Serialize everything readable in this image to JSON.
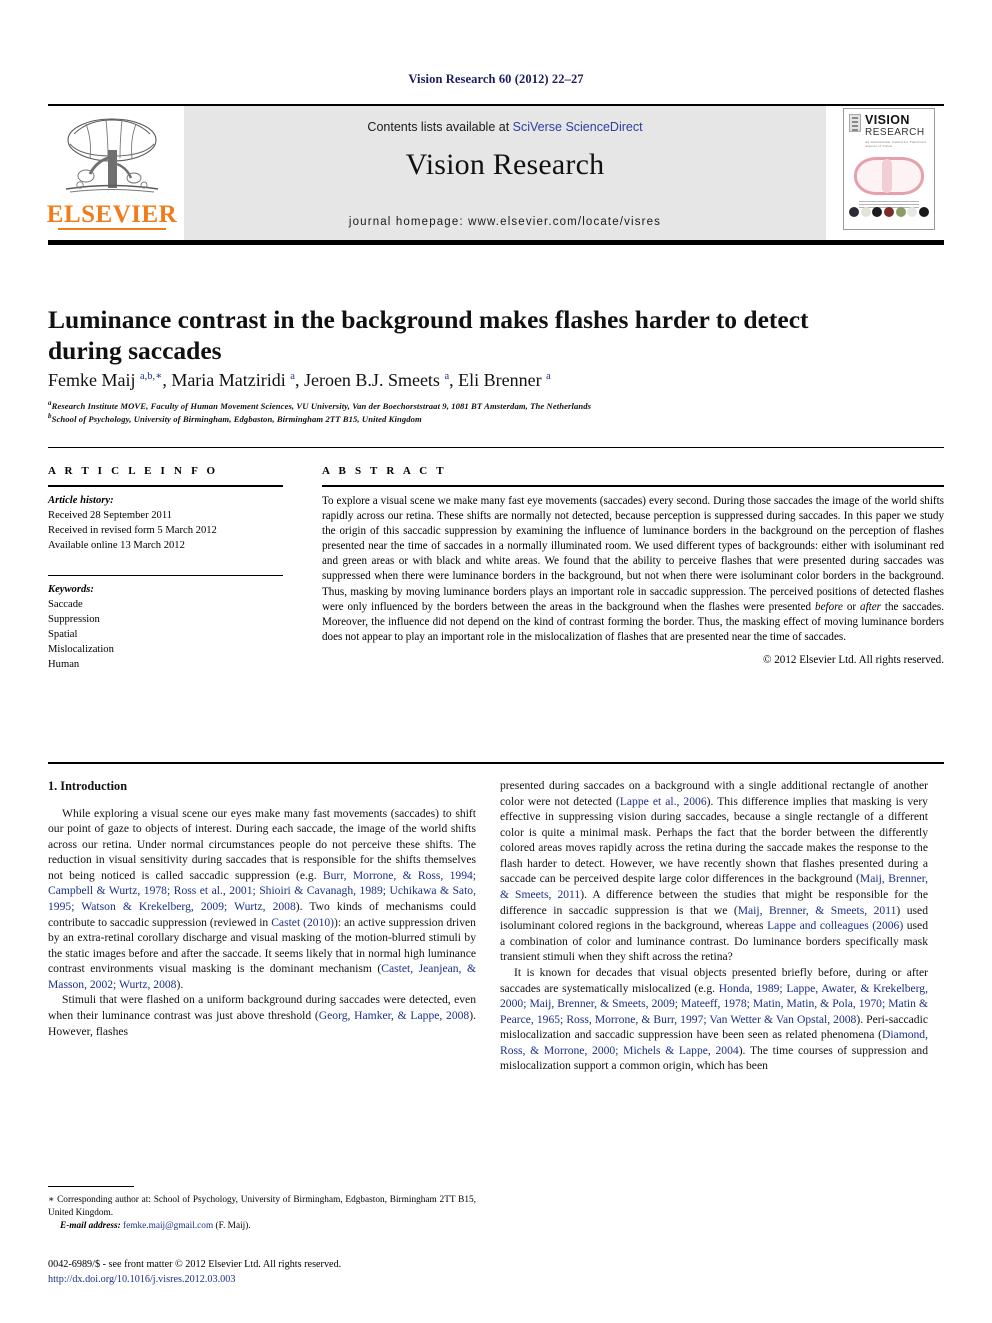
{
  "running_head": "Vision Research 60 (2012) 22–27",
  "masthead": {
    "publisher": "ELSEVIER",
    "contents_prefix": "Contents lists available at ",
    "contents_link": "SciVerse ScienceDirect",
    "journal_name": "Vision Research",
    "homepage": "journal homepage: www.elsevier.com/locate/visres",
    "cover": {
      "title_line1": "VISION",
      "title_line2": "RESEARCH",
      "subtitle": "An International Journal for Functional Aspects of Vision"
    }
  },
  "article": {
    "title": "Luminance contrast in the background makes flashes harder to detect during saccades",
    "authors_html": "Femke Maij <sup>a,b,∗</sup>, Maria Matziridi <sup>a</sup>, Jeroen B.J. Smeets <sup>a</sup>, Eli Brenner <sup>a</sup>",
    "affiliation_a": "Research Institute MOVE, Faculty of Human Movement Sciences, VU University, Van der Boechorststraat 9, 1081 BT Amsterdam, The Netherlands",
    "affiliation_b": "School of Psychology, University of Birmingham, Edgbaston, Birmingham 2TT B15, United Kingdom"
  },
  "article_info": {
    "heading": "A R T I C L E    I N F O",
    "history_label": "Article history:",
    "received": "Received 28 September 2011",
    "revised": "Received in revised form 5 March 2012",
    "available": "Available online 13 March 2012",
    "keywords_label": "Keywords:",
    "keywords": [
      "Saccade",
      "Suppression",
      "Spatial",
      "Mislocalization",
      "Human"
    ]
  },
  "abstract": {
    "heading": "A B S T R A C T",
    "text_part1": "To explore a visual scene we make many fast eye movements (saccades) every second. During those saccades the image of the world shifts rapidly across our retina. These shifts are normally not detected, because perception is suppressed during saccades. In this paper we study the origin of this saccadic suppression by examining the influence of luminance borders in the background on the perception of flashes presented near the time of saccades in a normally illuminated room. We used different types of backgrounds: either with isoluminant red and green areas or with black and white areas. We found that the ability to perceive flashes that were presented during saccades was suppressed when there were luminance borders in the background, but not when there were isoluminant color borders in the background. Thus, masking by moving luminance borders plays an important role in saccadic suppression. The perceived positions of detected flashes were only influenced by the borders between the areas in the background when the flashes were presented ",
    "emph1": "before",
    "text_part2": " or ",
    "emph2": "after",
    "text_part3": " the saccades. Moreover, the influence did not depend on the kind of contrast forming the border. Thus, the masking effect of moving luminance borders does not appear to play an important role in the mislocalization of flashes that are presented near the time of saccades.",
    "copyright": "© 2012 Elsevier Ltd. All rights reserved."
  },
  "body": {
    "section_heading": "1. Introduction",
    "left_p1_a": "While exploring a visual scene our eyes make many fast movements (saccades) to shift our point of gaze to objects of interest. During each saccade, the image of the world shifts across our retina. Under normal circumstances people do not perceive these shifts. The reduction in visual sensitivity during saccades that is responsible for the shifts themselves not being noticed is called saccadic suppression (e.g. ",
    "left_p1_cite1": "Burr, Morrone, & Ross, 1994; Campbell & Wurtz, 1978; Ross et al., 2001; Shioiri & Cavanagh, 1989; Uchikawa & Sato, 1995; Watson & Krekelberg, 2009; Wurtz, 2008",
    "left_p1_b": "). Two kinds of mechanisms could contribute to saccadic suppression (reviewed in ",
    "left_p1_cite2": "Castet (2010)",
    "left_p1_c": "): an active suppression driven by an extra-retinal corollary discharge and visual masking of the motion-blurred stimuli by the static images before and after the saccade. It seems likely that in normal high luminance contrast environments visual masking is the dominant mechanism (",
    "left_p1_cite3": "Castet, Jeanjean, & Masson, 2002; Wurtz, 2008",
    "left_p1_d": ").",
    "left_p2_a": "Stimuli that were flashed on a uniform background during saccades were detected, even when their luminance contrast was just above threshold (",
    "left_p2_cite1": "Georg, Hamker, & Lappe, 2008",
    "left_p2_b": "). However, flashes",
    "right_p1_a": "presented during saccades on a background with a single additional rectangle of another color were not detected (",
    "right_p1_cite1": "Lappe et al., 2006",
    "right_p1_b": "). This difference implies that masking is very effective in suppressing vision during saccades, because a single rectangle of a different color is quite a minimal mask. Perhaps the fact that the border between the differently colored areas moves rapidly across the retina during the saccade makes the response to the flash harder to detect. However, we have recently shown that flashes presented during a saccade can be perceived despite large color differences in the background (",
    "right_p1_cite2": "Maij, Brenner, & Smeets, 2011",
    "right_p1_c": "). A difference between the studies that might be responsible for the difference in saccadic suppression is that we (",
    "right_p1_cite3": "Maij, Brenner, & Smeets, 2011",
    "right_p1_d": ") used isoluminant colored regions in the background, whereas ",
    "right_p1_cite4": "Lappe and colleagues (2006)",
    "right_p1_e": " used a combination of color and luminance contrast. Do luminance borders specifically mask transient stimuli when they shift across the retina?",
    "right_p2_a": "It is known for decades that visual objects presented briefly before, during or after saccades are systematically mislocalized (e.g. ",
    "right_p2_cite1": "Honda, 1989; Lappe, Awater, & Krekelberg, 2000; Maij, Brenner, & Smeets, 2009; Mateeff, 1978; Matin, Matin, & Pola, 1970; Matin & Pearce, 1965; Ross, Morrone, & Burr, 1997; Van Wetter & Van Opstal, 2008",
    "right_p2_b": "). Peri-saccadic mislocalization and saccadic suppression have been seen as related phenomena (",
    "right_p2_cite2": "Diamond, Ross, & Morrone, 2000; Michels & Lappe, 2004",
    "right_p2_c": "). The time courses of suppression and mislocalization support a common origin, which has been"
  },
  "footnote": {
    "corresponding": "∗ Corresponding author at: School of Psychology, University of Birmingham, Edgbaston, Birmingham 2TT B15, United Kingdom.",
    "email_label": "E-mail address:",
    "email": "femke.maij@gmail.com",
    "email_suffix": " (F. Maij)."
  },
  "footer": {
    "issn_line": "0042-6989/$ - see front matter © 2012 Elsevier Ltd. All rights reserved.",
    "doi": "http://dx.doi.org/10.1016/j.visres.2012.03.003"
  },
  "colors": {
    "citation_blue": "#1b2f8a",
    "elsevier_orange": "#f07c1a",
    "masthead_gray": "#e6e6e6",
    "runhead_navy": "#1b1b5e"
  }
}
